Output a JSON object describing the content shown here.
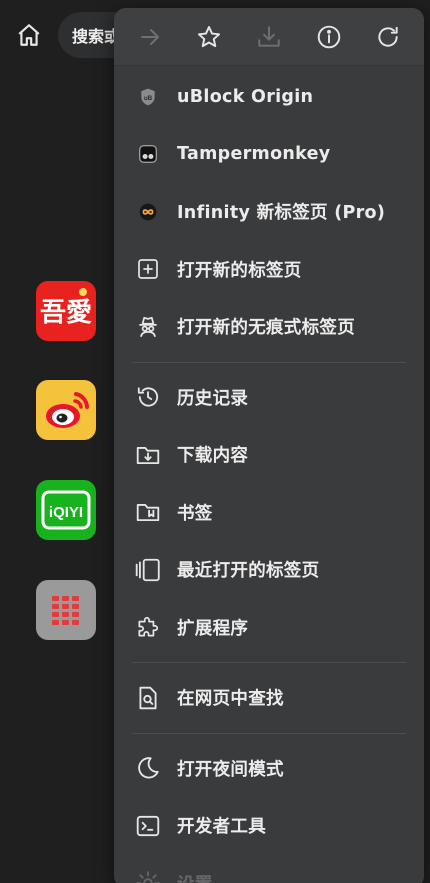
{
  "background": {
    "search_text": "搜索或",
    "apps": [
      {
        "name": "52pojie",
        "text": "吾愛",
        "color": "#e8221f"
      },
      {
        "name": "weibo",
        "color": "#f5c33b"
      },
      {
        "name": "iqiyi",
        "text": "iQIYI",
        "color": "#17b21d"
      },
      {
        "name": "folder",
        "color": "#9a9a9a"
      }
    ]
  },
  "toolbar": {
    "buttons": [
      "forward-icon",
      "star-icon",
      "download-icon",
      "info-icon",
      "reload-icon"
    ]
  },
  "menu": {
    "extensions": [
      {
        "label": "uBlock Origin",
        "icon": "ublock-icon"
      },
      {
        "label": "Tampermonkey",
        "icon": "tampermonkey-icon"
      },
      {
        "label": "Infinity 新标签页 (Pro)",
        "icon": "infinity-icon"
      }
    ],
    "tabs": [
      {
        "label": "打开新的标签页",
        "icon": "new-tab-icon"
      },
      {
        "label": "打开新的无痕式标签页",
        "icon": "incognito-icon"
      }
    ],
    "history": [
      {
        "label": "历史记录",
        "icon": "history-icon"
      },
      {
        "label": "下载内容",
        "icon": "downloads-icon"
      },
      {
        "label": "书签",
        "icon": "bookmarks-icon"
      },
      {
        "label": "最近打开的标签页",
        "icon": "recent-tabs-icon"
      },
      {
        "label": "扩展程序",
        "icon": "extensions-icon"
      }
    ],
    "find": [
      {
        "label": "在网页中查找",
        "icon": "find-in-page-icon"
      }
    ],
    "tools": [
      {
        "label": "打开夜间模式",
        "icon": "night-mode-icon"
      },
      {
        "label": "开发者工具",
        "icon": "dev-tools-icon"
      },
      {
        "label": "设置",
        "icon": "settings-icon"
      }
    ]
  }
}
